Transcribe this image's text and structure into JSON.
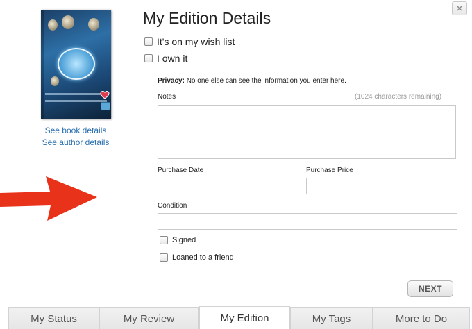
{
  "dialog": {
    "title": "My Edition Details",
    "close_glyph": "×"
  },
  "book": {
    "cover_icon": "book-cover",
    "links": {
      "book_details": "See book details",
      "author_details": "See author details"
    }
  },
  "options": {
    "wish_list": "It's on my wish list",
    "own_it": "I own it"
  },
  "privacy": {
    "label": "Privacy:",
    "text": "No one else can see the information you enter here."
  },
  "notes": {
    "label": "Notes",
    "remaining": "(1024 characters remaining)",
    "value": ""
  },
  "purchase": {
    "date_label": "Purchase Date",
    "date_value": "",
    "price_label": "Purchase Price",
    "price_value": ""
  },
  "condition": {
    "label": "Condition",
    "value": ""
  },
  "flags": {
    "signed": "Signed",
    "loaned": "Loaned to a friend"
  },
  "actions": {
    "next": "NEXT"
  },
  "tabs": [
    {
      "label": "My Status"
    },
    {
      "label": "My Review"
    },
    {
      "label": "My Edition"
    },
    {
      "label": "My Tags"
    },
    {
      "label": "More to Do"
    }
  ],
  "active_tab": "My Edition",
  "colors": {
    "link": "#2a6fb0",
    "arrow": "#e8321a"
  }
}
